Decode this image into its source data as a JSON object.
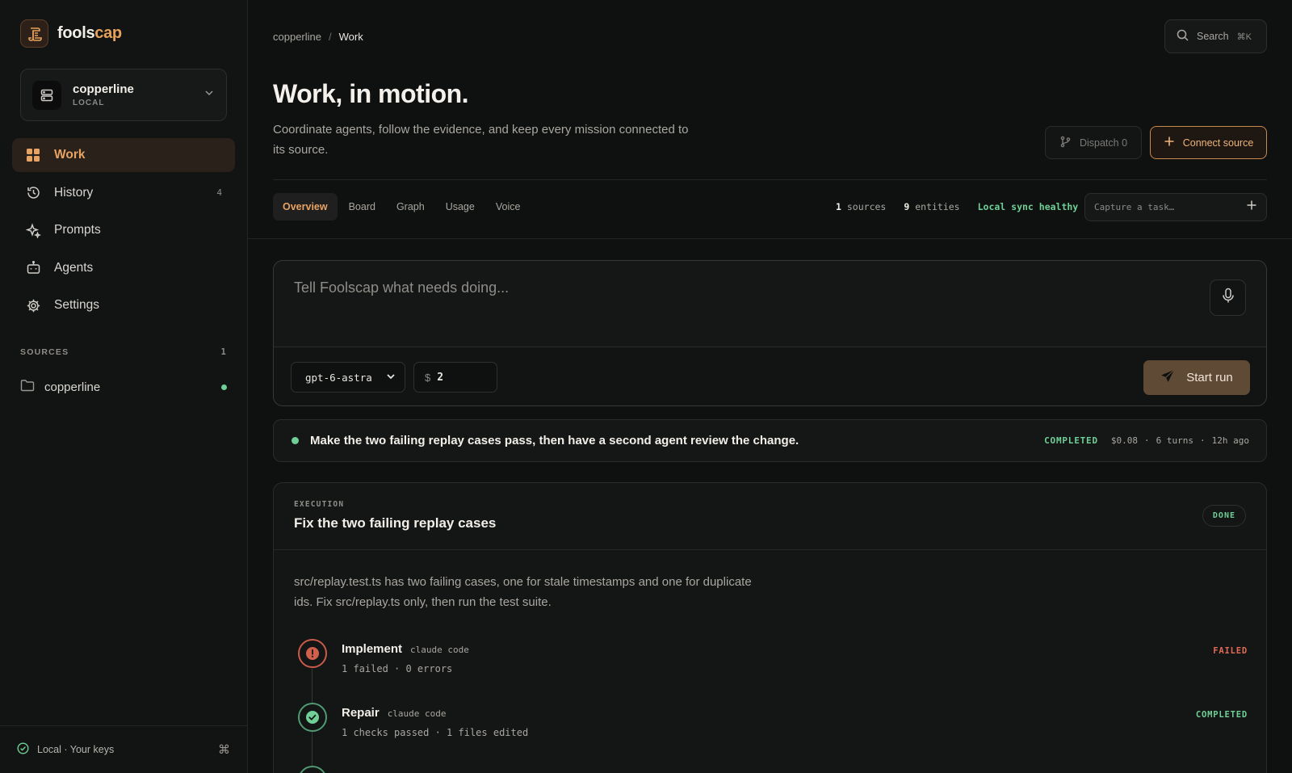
{
  "brand": {
    "name_prefix": "fools",
    "name_suffix": "cap"
  },
  "workspace": {
    "name": "copperline",
    "kind": "LOCAL"
  },
  "nav": [
    {
      "label": "Work",
      "icon": "grid-icon",
      "active": true,
      "count": ""
    },
    {
      "label": "History",
      "icon": "history-icon",
      "active": false,
      "count": "4"
    },
    {
      "label": "Prompts",
      "icon": "sparkle-icon",
      "active": false,
      "count": ""
    },
    {
      "label": "Agents",
      "icon": "robot-icon",
      "active": false,
      "count": ""
    },
    {
      "label": "Settings",
      "icon": "gear-icon",
      "active": false,
      "count": ""
    }
  ],
  "sources": {
    "heading": "SOURCES",
    "count": "1",
    "items": [
      {
        "label": "copperline",
        "status_color": "#6fcf97"
      }
    ]
  },
  "footer": {
    "label": "Local · Your keys",
    "shortcut": "⌘"
  },
  "breadcrumb": {
    "parent": "copperline",
    "separator": "/",
    "current": "Work"
  },
  "search": {
    "label": "Search",
    "shortcut": "⌘K"
  },
  "page": {
    "title": "Work, in motion.",
    "subtitle": "Coordinate agents, follow the evidence, and keep every mission connected to its source."
  },
  "actions": {
    "dispatch": "Dispatch 0",
    "connect": "Connect source"
  },
  "tabs": [
    {
      "label": "Overview",
      "active": true
    },
    {
      "label": "Board",
      "active": false
    },
    {
      "label": "Graph",
      "active": false
    },
    {
      "label": "Usage",
      "active": false
    },
    {
      "label": "Voice",
      "active": false
    }
  ],
  "stats": {
    "sources_count": "1",
    "sources_label": "sources",
    "entities_count": "9",
    "entities_label": "entities",
    "sync": "Local sync healthy"
  },
  "capture": {
    "placeholder": "Capture a task…"
  },
  "composer": {
    "placeholder": "Tell Foolscap what needs doing...",
    "model": "gpt-6-astra",
    "budget_symbol": "$",
    "budget": "2",
    "start_label": "Start run"
  },
  "run": {
    "text": "Make the two failing replay cases pass, then have a second agent review the change.",
    "status": "COMPLETED",
    "cost": "$0.08",
    "turns": "6 turns",
    "age": "12h ago",
    "separator": "·"
  },
  "execution": {
    "kicker": "EXECUTION",
    "title": "Fix the two failing replay cases",
    "badge": "DONE",
    "description": "src/replay.test.ts has two failing cases, one for stale timestamps and one for duplicate ids. Fix src/replay.ts only, then run the test suite.",
    "steps": [
      {
        "name": "Implement",
        "agent": "claude code",
        "detail": "1 failed · 0 errors",
        "status": "FAILED",
        "state": "failed"
      },
      {
        "name": "Repair",
        "agent": "claude code",
        "detail": "1 checks passed · 1 files edited",
        "status": "COMPLETED",
        "state": "ok"
      }
    ]
  },
  "colors": {
    "accent": "#e8a263",
    "success": "#6fcf97",
    "danger": "#e06b55",
    "background": "#0f1010"
  }
}
